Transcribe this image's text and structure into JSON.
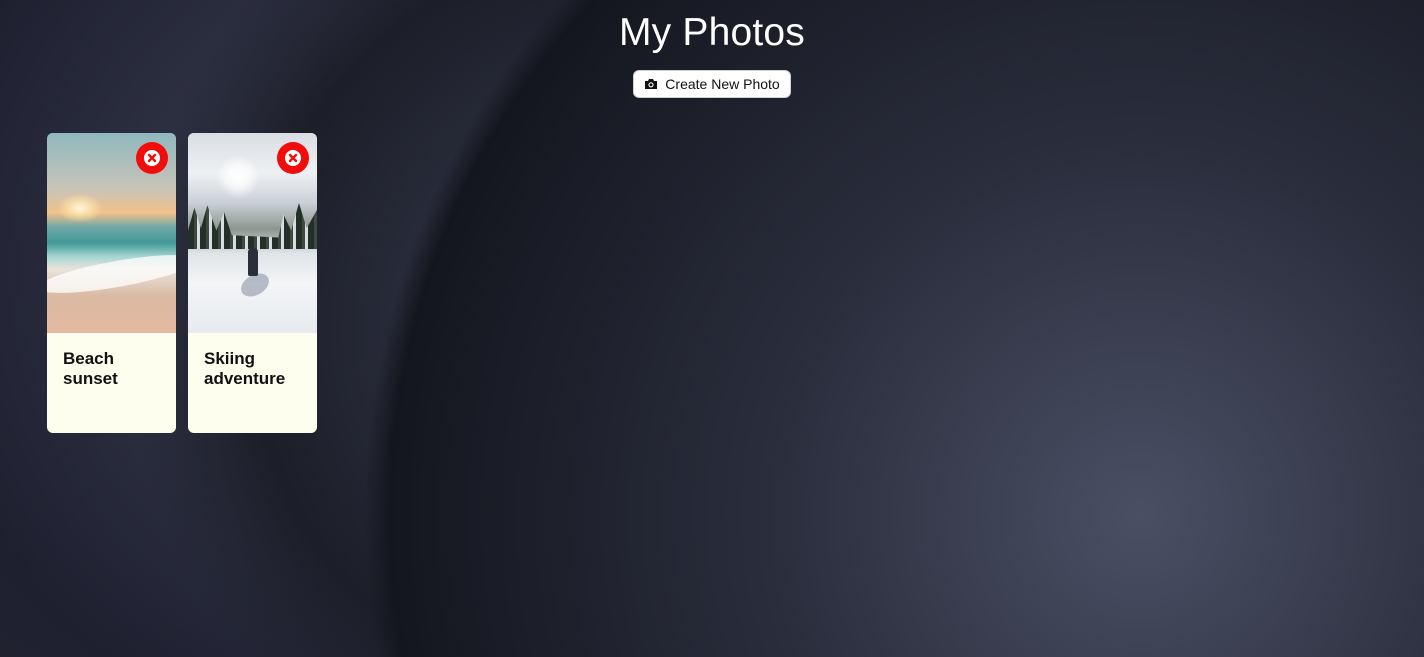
{
  "header": {
    "title": "My Photos",
    "create_button": {
      "label": "Create New Photo",
      "icon": "camera-icon"
    }
  },
  "photos": [
    {
      "caption": "Beach sunset",
      "image": "beach-sunset-photo",
      "delete_icon": "close-circle-icon"
    },
    {
      "caption": "Skiing adventure",
      "image": "skiing-photo",
      "delete_icon": "close-circle-icon"
    }
  ],
  "colors": {
    "delete_button": "#f20d0d",
    "card_background": "#fefeef",
    "title_text": "#ffffff"
  }
}
